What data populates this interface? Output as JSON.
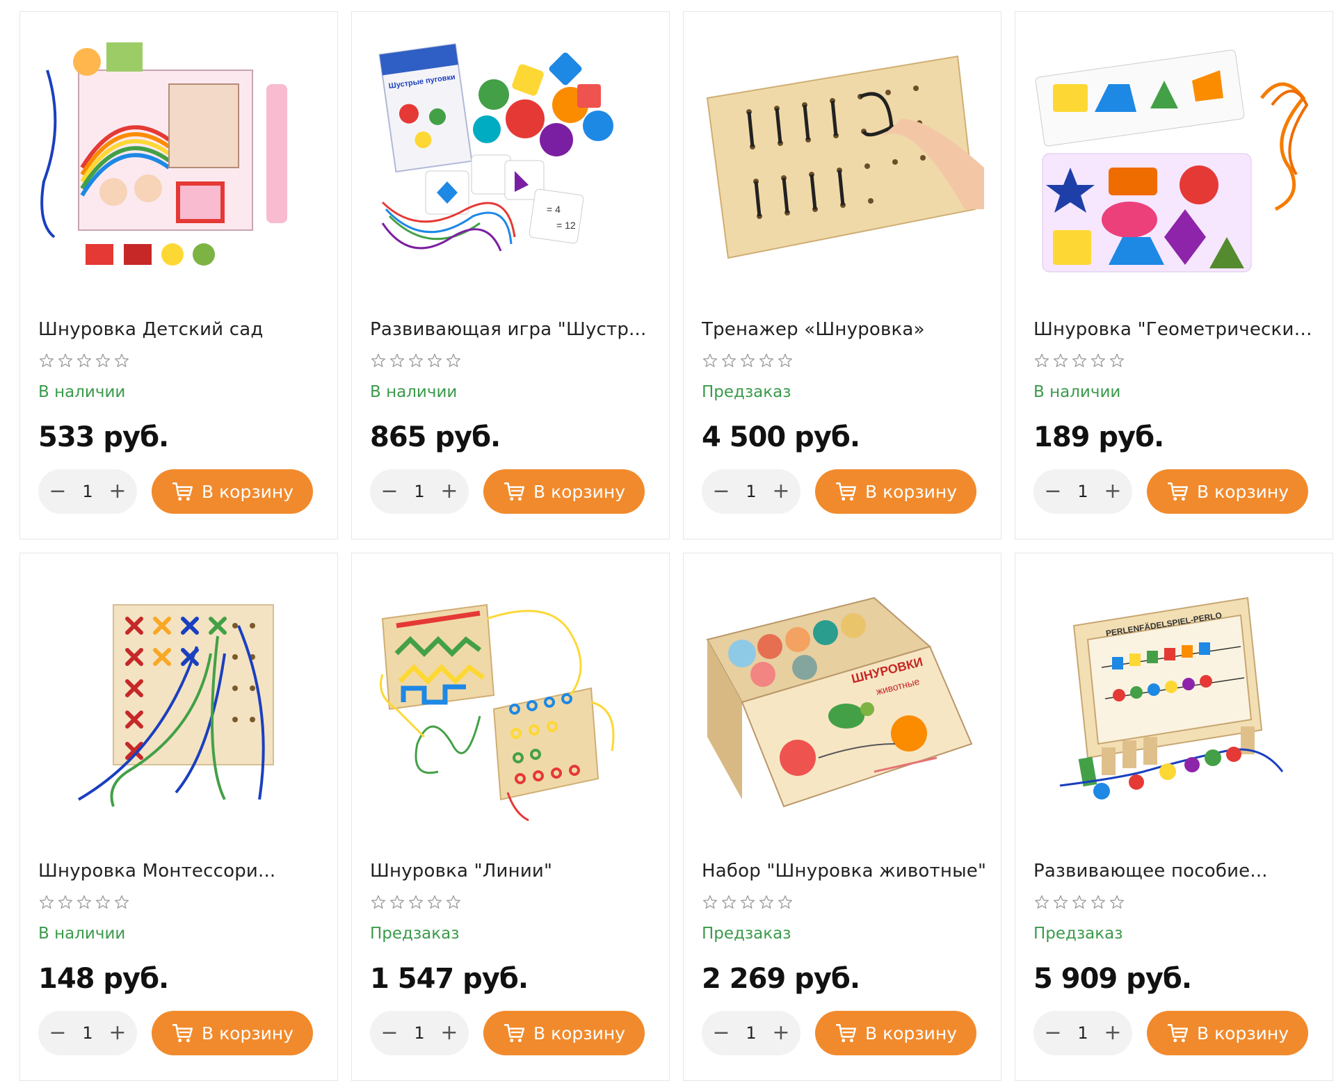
{
  "colors": {
    "accent": "#f18a2c",
    "in_stock": "#3a9a4a",
    "card_border": "#e6e6e6"
  },
  "cart_label": "В корзину",
  "products": [
    {
      "title": "Шнуровка Детский сад",
      "availability": "В наличии",
      "price": "533 руб.",
      "qty": "1",
      "rating": 0
    },
    {
      "title": "Развивающая игра \"Шустр...",
      "availability": "В наличии",
      "price": "865 руб.",
      "qty": "1",
      "rating": 0
    },
    {
      "title": "Тренажер «Шнуровка»",
      "availability": "Предзаказ",
      "price": "4 500 руб.",
      "qty": "1",
      "rating": 0
    },
    {
      "title": "Шнуровка \"Геометрические...",
      "availability": "В наличии",
      "price": "189 руб.",
      "qty": "1",
      "rating": 0
    },
    {
      "title": "Шнуровка Монтессори...",
      "availability": "В наличии",
      "price": "148 руб.",
      "qty": "1",
      "rating": 0
    },
    {
      "title": "Шнуровка \"Линии\"",
      "availability": "Предзаказ",
      "price": "1 547 руб.",
      "qty": "1",
      "rating": 0
    },
    {
      "title": "Набор \"Шнуровка животные\"",
      "availability": "Предзаказ",
      "price": "2 269 руб.",
      "qty": "1",
      "rating": 0
    },
    {
      "title": "Развивающее пособие...",
      "availability": "Предзаказ",
      "price": "5 909 руб.",
      "qty": "1",
      "rating": 0
    }
  ],
  "image_text": {
    "p2_box": "Шустрые пуговки",
    "p2_card1": "= 4",
    "p2_card2": "= 12",
    "p7_box_line1": "ШНУРОВКИ",
    "p7_box_line2": "животные",
    "p8_box": "PERLENFÄDELSPIEL-PERLO"
  }
}
